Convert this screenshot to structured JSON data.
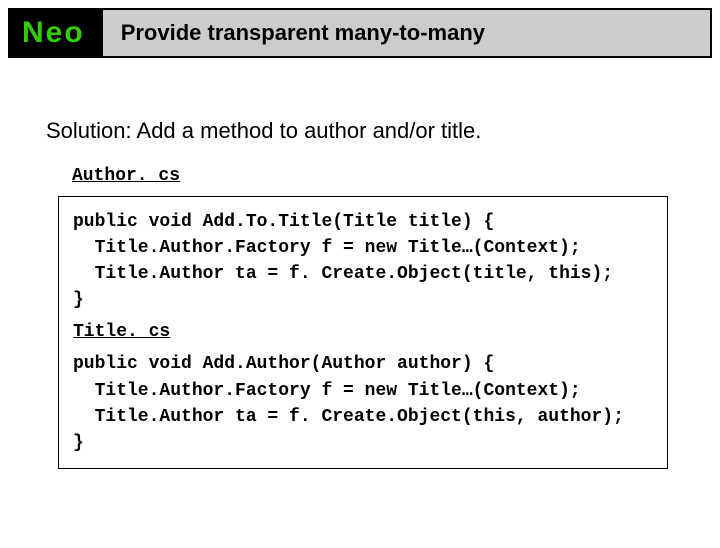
{
  "header": {
    "logo": "Neo",
    "title": "Provide transparent many-to-many"
  },
  "solution_text": "Solution: Add a method to author and/or title.",
  "file1_label": "Author. cs",
  "code": {
    "block1_line1": "public void Add.To.Title(Title title) {",
    "block1_line2": "  Title.Author.Factory f = new Title…(Context);",
    "block1_line3": "  Title.Author ta = f. Create.Object(title, this);",
    "block1_line4": "}",
    "file2_label": "Title. cs",
    "block2_line1": "public void Add.Author(Author author) {",
    "block2_line2": "  Title.Author.Factory f = new Title…(Context);",
    "block2_line3": "  Title.Author ta = f. Create.Object(this, author);",
    "block2_line4": "}"
  }
}
